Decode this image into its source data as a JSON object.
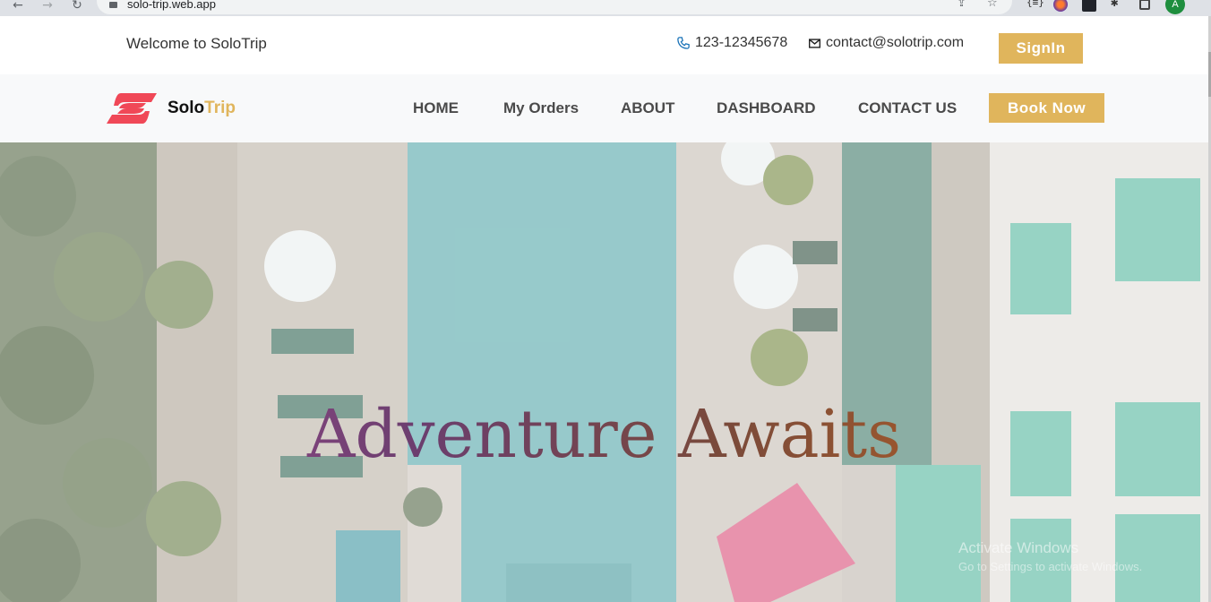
{
  "browser": {
    "url": "solo-trip.web.app",
    "avatar_letter": "A"
  },
  "topbar": {
    "welcome": "Welcome to SoloTrip",
    "phone": "123-12345678",
    "email": "contact@solotrip.com",
    "signin_label": "SignIn"
  },
  "navbar": {
    "brand_part1": "Solo",
    "brand_part2": "Trip",
    "links": [
      "HOME",
      "My Orders",
      "ABOUT",
      "DASHBOARD",
      "CONTACT US"
    ],
    "book_label": "Book Now"
  },
  "hero": {
    "title": "Adventure Awaits"
  },
  "watermark": {
    "line1": "Activate Windows",
    "line2": "Go to Settings to activate Windows."
  },
  "colors": {
    "accent": "#e0b55c",
    "logo": "#f04857",
    "pool": "#7fb9bb"
  }
}
